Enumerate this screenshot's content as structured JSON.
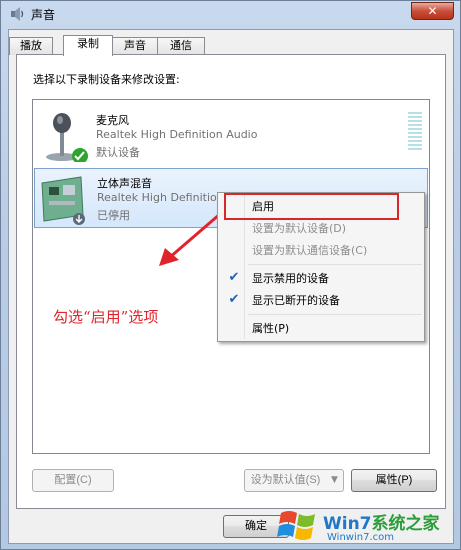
{
  "window": {
    "title": "声音",
    "close_label": "✕"
  },
  "tabs": [
    {
      "label": "播放",
      "active": false
    },
    {
      "label": "录制",
      "active": true
    },
    {
      "label": "声音",
      "active": false
    },
    {
      "label": "通信",
      "active": false
    }
  ],
  "panel": {
    "instruction": "选择以下录制设备来修改设置:"
  },
  "devices": [
    {
      "name": "麦克风",
      "description": "Realtek High Definition Audio",
      "status": "默认设备",
      "icon": "microphone-icon",
      "badge": "default-check-icon",
      "selected": false
    },
    {
      "name": "立体声混音",
      "description": "Realtek High Definition Audio",
      "status": "已停用",
      "icon": "sound-card-icon",
      "badge": "disabled-arrow-icon",
      "selected": true
    }
  ],
  "context_menu": {
    "items": [
      {
        "label": "启用",
        "disabled": false,
        "checked": false
      },
      {
        "label": "设置为默认设备(D)",
        "disabled": true,
        "checked": false
      },
      {
        "label": "设置为默认通信设备(C)",
        "disabled": true,
        "checked": false
      },
      {
        "label": "显示禁用的设备",
        "disabled": false,
        "checked": true
      },
      {
        "label": "显示已断开的设备",
        "disabled": false,
        "checked": true
      },
      {
        "label": "属性(P)",
        "disabled": false,
        "checked": false
      }
    ]
  },
  "annotation": "勾选“启用”选项",
  "buttons": {
    "configure": "配置(C)",
    "set_default": "设为默认值(S)",
    "properties": "属性(P)",
    "ok": "确定"
  },
  "watermark": {
    "brand": "Win7系统之家",
    "brand_a": "Win7",
    "brand_b": "系统之家",
    "url": "Winwin7.com"
  },
  "colors": {
    "annotation": "#e0242b",
    "highlight_box": "#d9262b",
    "selection": "#d5e7fc"
  }
}
